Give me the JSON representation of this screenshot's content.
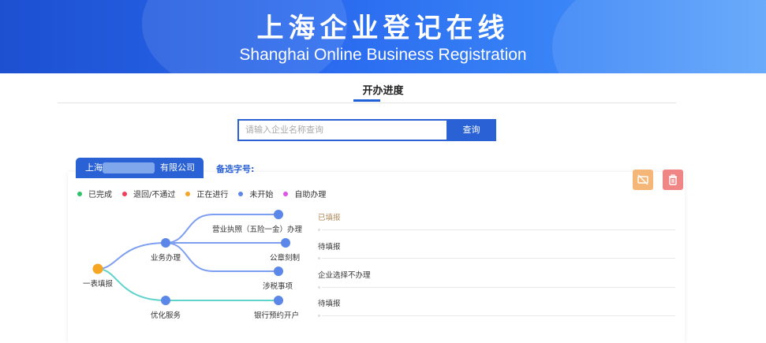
{
  "banner": {
    "title_cn": "上海企业登记在线",
    "title_en": "Shanghai Online Business Registration"
  },
  "tabs": {
    "active": "开办进度"
  },
  "search": {
    "placeholder": "请输入企业名称查询",
    "button": "查询"
  },
  "company": {
    "name_prefix": "上海",
    "name_suffix": "有限公司",
    "alt_name_label": "备选字号:"
  },
  "actions": {
    "unbind_icon": "unlink-icon",
    "delete_icon": "trash-icon",
    "unbind_color": "#f5b777",
    "delete_color": "#f08585"
  },
  "legend": [
    {
      "label": "已完成",
      "color": "#2ec26b"
    },
    {
      "label": "退回/不通过",
      "color": "#f03e5c"
    },
    {
      "label": "正在进行",
      "color": "#f5a623"
    },
    {
      "label": "未开始",
      "color": "#5b87e8"
    },
    {
      "label": "自助办理",
      "color": "#e052e8"
    }
  ],
  "flow": {
    "root": "一表填报",
    "branch_business": "业务办理",
    "branch_optimize": "优化服务",
    "leaf_license": "营业执照（五险一金）办理",
    "leaf_seal": "公章刻制",
    "leaf_tax": "涉税事项",
    "leaf_bank": "银行预约开户"
  },
  "statuses": [
    {
      "text": "已填报",
      "color": "#b08a5a"
    },
    {
      "text": "待填报",
      "color": "#333333"
    },
    {
      "text": "企业选择不办理",
      "color": "#333333"
    },
    {
      "text": "待填报",
      "color": "#333333"
    }
  ]
}
